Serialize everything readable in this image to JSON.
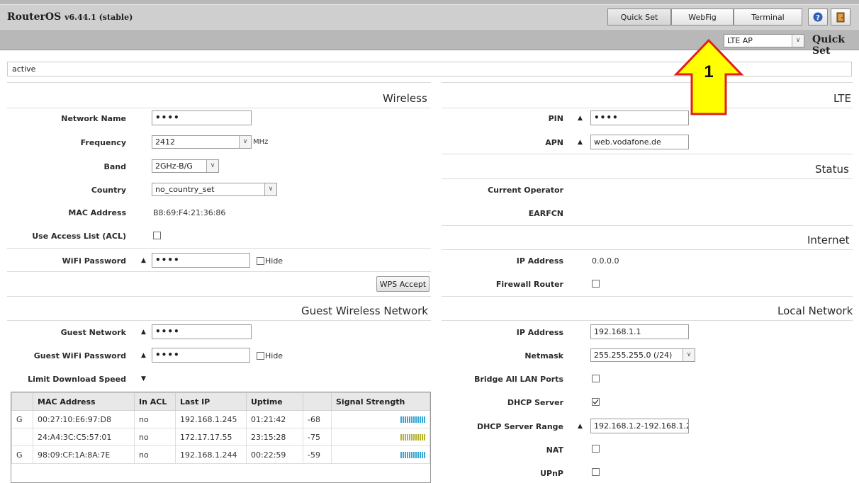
{
  "header": {
    "brand": "RouterOS",
    "version": "v6.44.1 (stable)",
    "buttons": {
      "quick_set": "Quick Set",
      "webfig": "WebFig",
      "terminal": "Terminal"
    },
    "icons": [
      "help-icon",
      "logout-icon"
    ],
    "mode_value": "LTE AP",
    "mode_title": "Quick Set"
  },
  "status": "active",
  "wireless": {
    "title": "Wireless",
    "network_name_label": "Network Name",
    "network_name_value": "••••",
    "frequency_label": "Frequency",
    "frequency_value": "2412",
    "frequency_unit": "MHz",
    "band_label": "Band",
    "band_value": "2GHz-B/G",
    "country_label": "Country",
    "country_value": "no_country_set",
    "mac_label": "MAC Address",
    "mac_value": "B8:69:F4:21:36:86",
    "acl_label": "Use Access List (ACL)",
    "password_label": "WiFi Password",
    "password_value": "••••",
    "hide_label": "Hide",
    "wps_button": "WPS Accept"
  },
  "guest": {
    "title": "Guest Wireless Network",
    "network_label": "Guest Network",
    "network_value": "••••",
    "password_label": "Guest WiFi Password",
    "password_value": "••••",
    "hide_label": "Hide",
    "limit_label": "Limit Download Speed"
  },
  "clients_table": {
    "headers": [
      "",
      "MAC Address",
      "In ACL",
      "Last IP",
      "Uptime",
      "",
      "Signal Strength"
    ],
    "rows": [
      {
        "flag": "G",
        "mac": "00:27:10:E6:97:D8",
        "in_acl": "no",
        "last_ip": "192.168.1.245",
        "uptime": "01:21:42",
        "signal": "-68"
      },
      {
        "flag": "",
        "mac": "24:A4:3C:C5:57:01",
        "in_acl": "no",
        "last_ip": "172.17.17.55",
        "uptime": "23:15:28",
        "signal": "-75"
      },
      {
        "flag": "G",
        "mac": "98:09:CF:1A:8A:7E",
        "in_acl": "no",
        "last_ip": "192.168.1.244",
        "uptime": "00:22:59",
        "signal": "-59"
      }
    ]
  },
  "lte": {
    "title": "LTE",
    "pin_label": "PIN",
    "pin_value": "••••",
    "apn_label": "APN",
    "apn_value": "web.vodafone.de"
  },
  "status_section": {
    "title": "Status",
    "operator_label": "Current Operator",
    "earfcn_label": "EARFCN"
  },
  "internet": {
    "title": "Internet",
    "ip_label": "IP Address",
    "ip_value": "0.0.0.0",
    "firewall_label": "Firewall Router"
  },
  "local": {
    "title": "Local Network",
    "ip_label": "IP Address",
    "ip_value": "192.168.1.1",
    "netmask_label": "Netmask",
    "netmask_value": "255.255.255.0 (/24)",
    "bridge_label": "Bridge All LAN Ports",
    "dhcp_label": "DHCP Server",
    "dhcp_range_label": "DHCP Server Range",
    "dhcp_range_value": "192.168.1.2-192.168.1.2",
    "nat_label": "NAT",
    "upnp_label": "UPnP"
  },
  "annotation": {
    "number": "1",
    "fill": "#ffff00",
    "stroke": "#e02020"
  }
}
